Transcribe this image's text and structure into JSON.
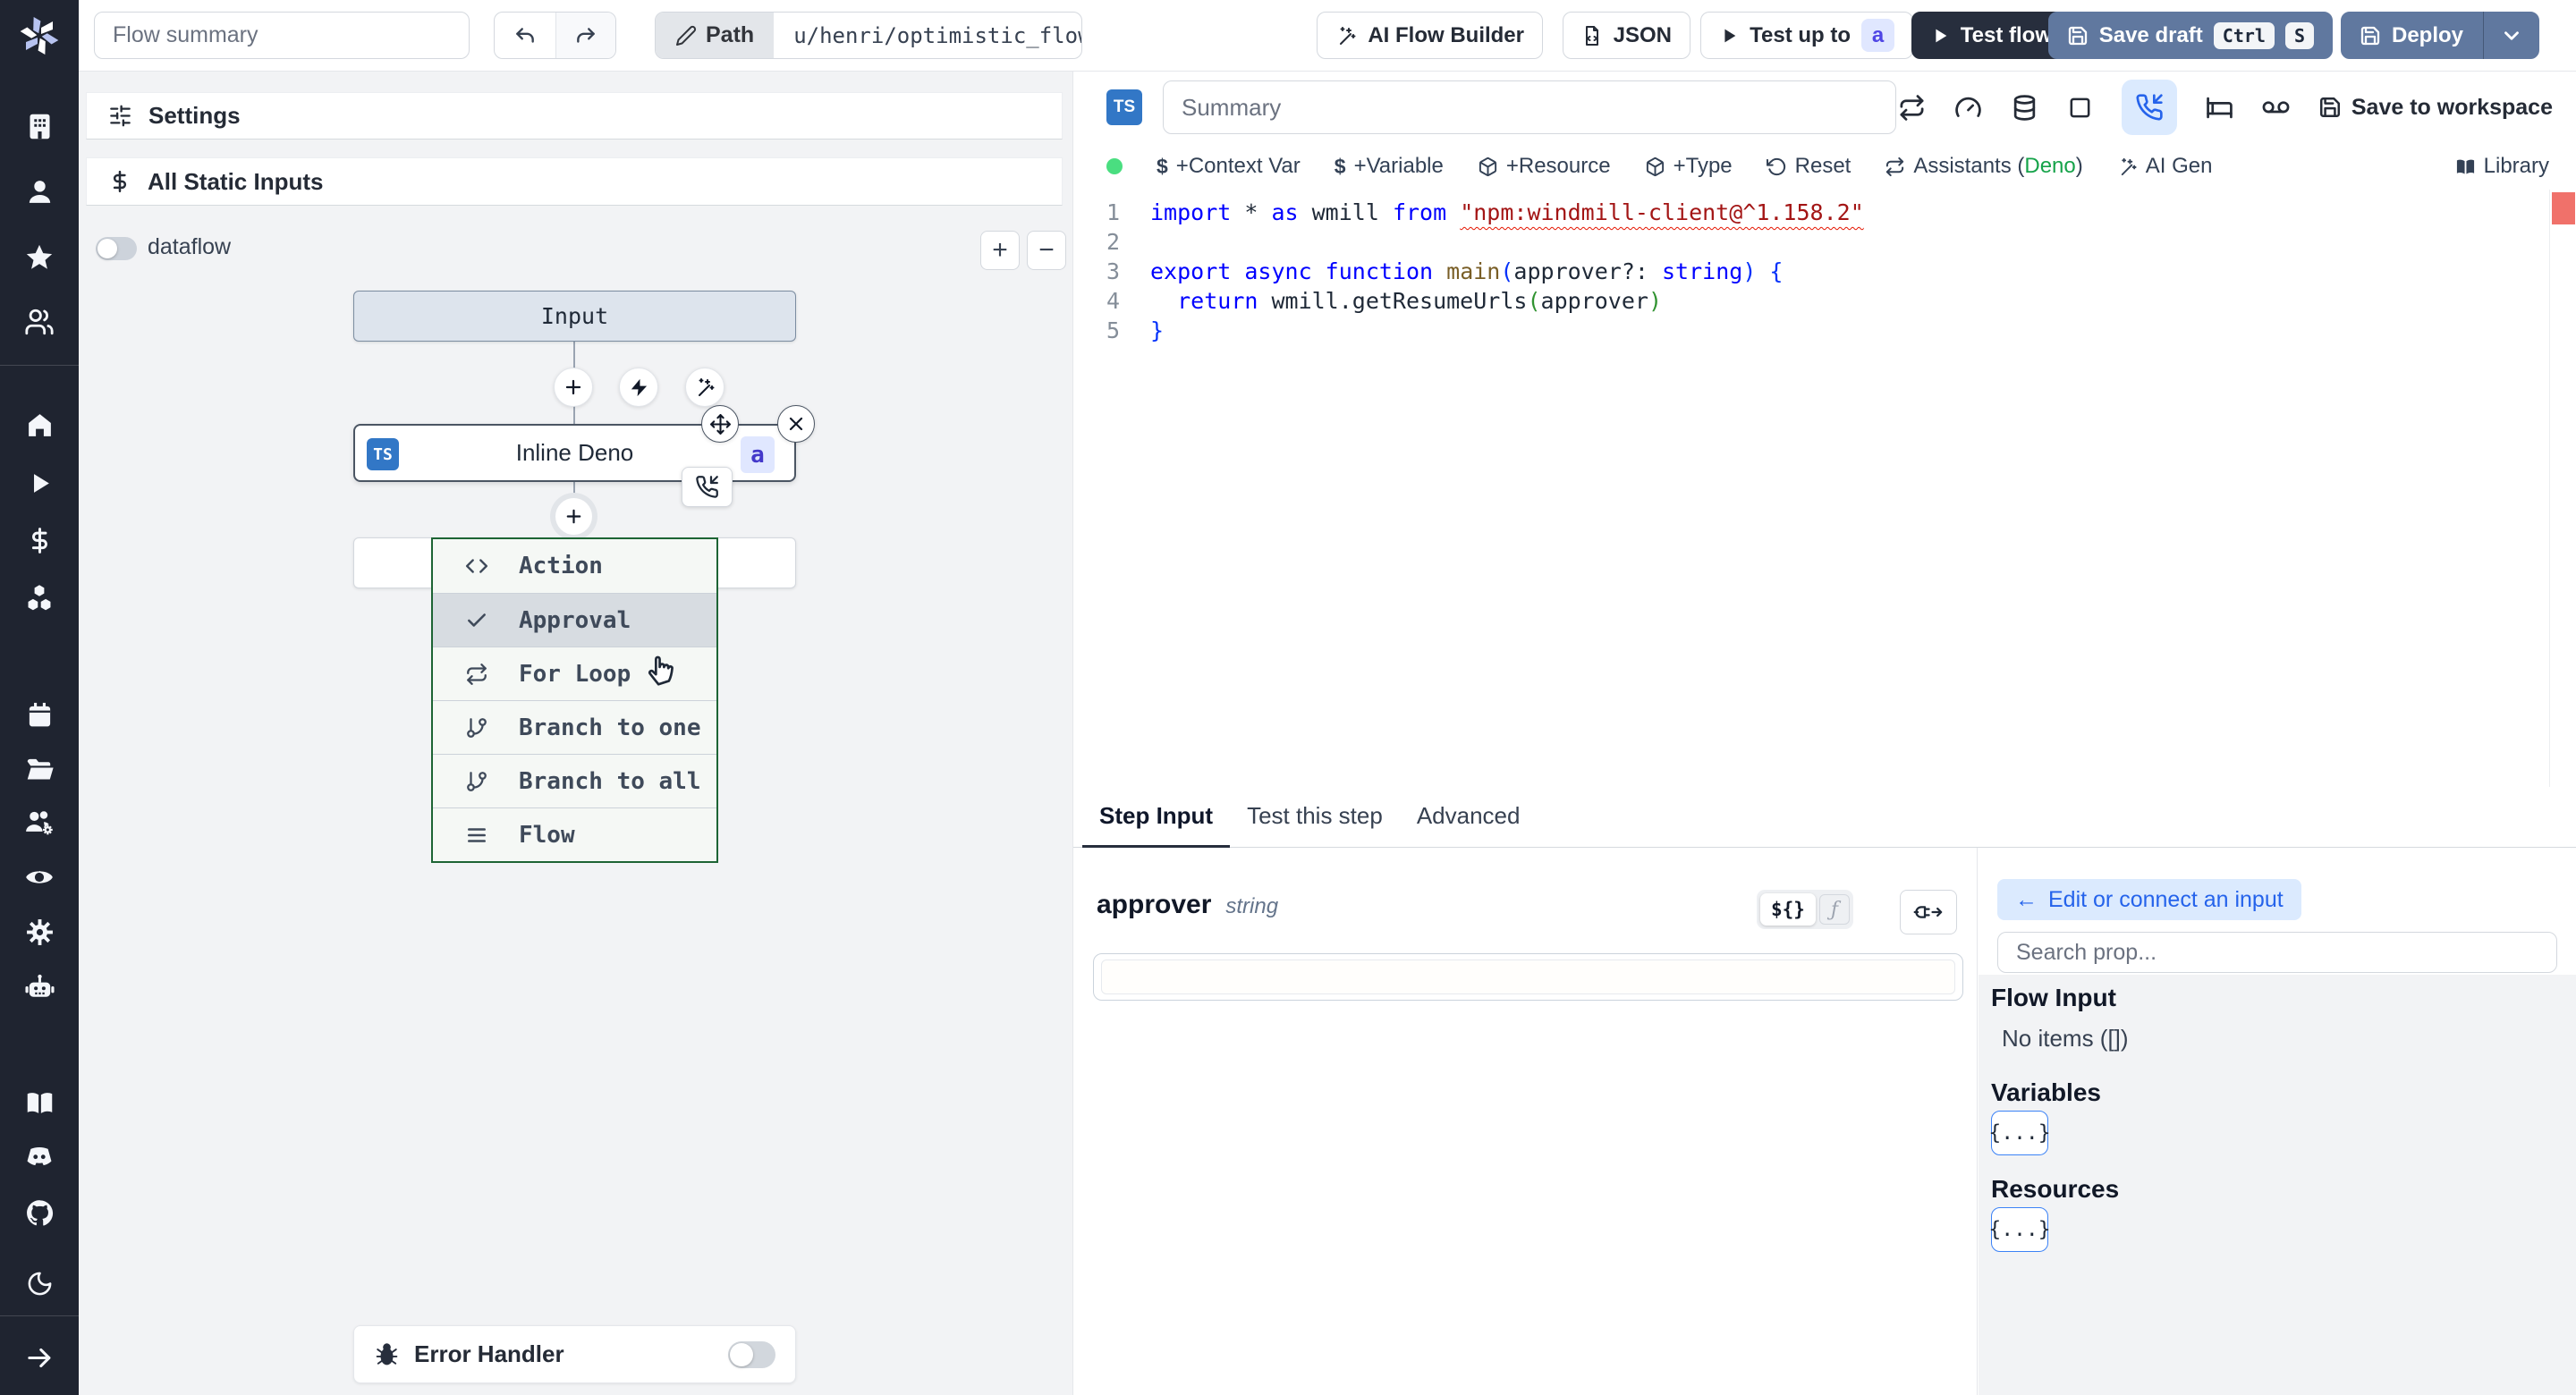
{
  "colors": {
    "sidebar_bg": "#1f2430",
    "accent_blue": "#2563eb",
    "slate_button": "#60789f",
    "dark_button": "#272e3d",
    "badge_indigo_bg": "#e0e7ff",
    "badge_indigo_text": "#4338ca",
    "deno_green": "#16a34a",
    "menu_border_green": "#1d6434",
    "status_dot_green": "#4ade80",
    "error_marker_red": "#f0716a",
    "ts_badge_blue": "#3277c6"
  },
  "sidebar": {
    "icons": [
      "windmill-logo",
      "building",
      "user",
      "star",
      "users",
      "home",
      "play",
      "dollar",
      "boxes",
      "calendar",
      "folder-open",
      "users-gear",
      "eye",
      "gear",
      "robot",
      "book",
      "discord",
      "github",
      "moon",
      "arrow-right"
    ]
  },
  "topbar": {
    "flow_summary_placeholder": "Flow summary",
    "path_label": "Path",
    "path_value": "u/henri/optimistic_flow",
    "ai_flow_builder": "AI Flow Builder",
    "json": "JSON",
    "test_up_to": "Test up to",
    "test_up_to_badge": "a",
    "test_flow": "Test flow",
    "save_draft": "Save draft",
    "kbd_ctrl": "Ctrl",
    "kbd_s": "S",
    "deploy": "Deploy"
  },
  "canvas": {
    "settings_label": "Settings",
    "static_inputs_label": "All Static Inputs",
    "dataflow_label": "dataflow",
    "zoom_in_label": "+",
    "zoom_out_label": "−",
    "input_node_label": "Input",
    "node": {
      "lang_badge": "TS",
      "label": "Inline Deno",
      "suffix_badge": "a"
    },
    "menu": {
      "items": [
        {
          "icon": "code-icon",
          "label": "Action"
        },
        {
          "icon": "check-icon",
          "label": "Approval"
        },
        {
          "icon": "repeat-icon",
          "label": "For Loop"
        },
        {
          "icon": "git-branch-icon",
          "label": "Branch to one"
        },
        {
          "icon": "git-branch-icon",
          "label": "Branch to all"
        },
        {
          "icon": "list-icon",
          "label": "Flow"
        }
      ]
    },
    "error_handler_label": "Error Handler"
  },
  "editor": {
    "lang_badge": "TS",
    "summary_placeholder": "Summary",
    "save_to_workspace": "Save to workspace",
    "toolbar": {
      "context_var": "+Context Var",
      "variable": "+Variable",
      "resource": "+Resource",
      "type": "+Type",
      "reset": "Reset",
      "assistants_prefix": "Assistants (",
      "assistants_lang": "Deno",
      "assistants_suffix": ")",
      "ai_gen": "AI Gen",
      "library": "Library"
    },
    "code": {
      "numbers": [
        "1",
        "2",
        "3",
        "4",
        "5"
      ],
      "l1": {
        "k1": "import ",
        "p1": "* ",
        "k2": "as ",
        "p2": "wmill ",
        "k3": "from ",
        "s1": "\"npm:windmill-client@^1.158.2\""
      },
      "l3": {
        "k1": "export async function ",
        "f1": "main",
        "b1": "(",
        "p1": "approver?: ",
        "k2": "string",
        "b2": ") {"
      },
      "l4": {
        "p0": "  ",
        "k1": "return ",
        "p1": "wmill.getResumeUrls",
        "b1": "(",
        "p2": "approver",
        "b2": ")"
      },
      "l5": {
        "b1": "}"
      }
    }
  },
  "step_panel": {
    "tabs": [
      "Step Input",
      "Test this step",
      "Advanced"
    ],
    "prop_name": "approver",
    "prop_type": "string",
    "mode_template": "${}",
    "mode_js": "ƒ"
  },
  "connect_panel": {
    "back_arrow": "←",
    "edit_connect_label": "Edit or connect an input",
    "search_placeholder": "Search prop...",
    "flow_input_title": "Flow Input",
    "flow_input_empty": "No items ([])",
    "variables_title": "Variables",
    "variables_button": "{...}",
    "resources_title": "Resources",
    "resources_button": "{...}"
  }
}
